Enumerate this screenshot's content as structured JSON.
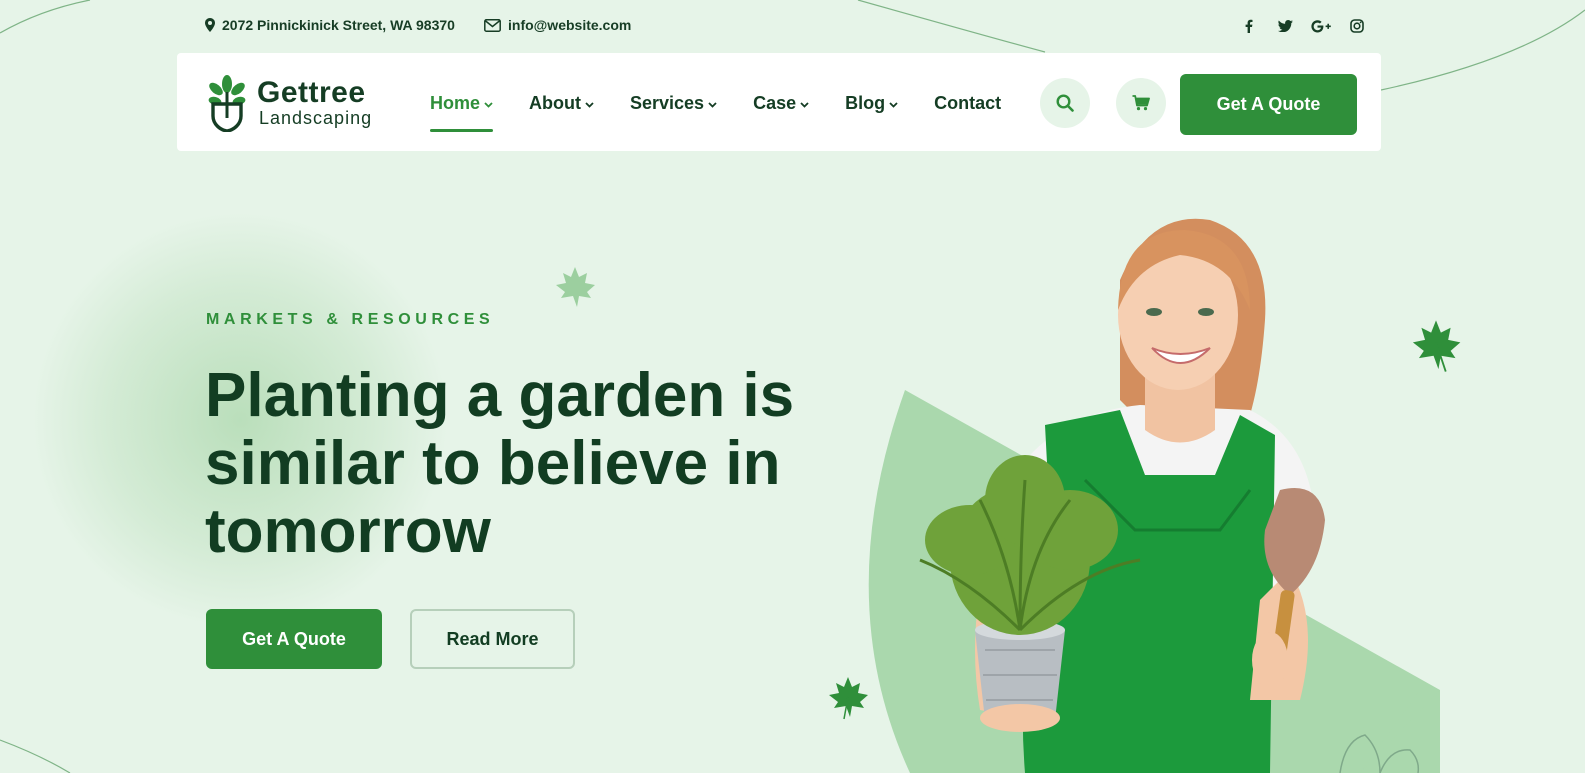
{
  "topbar": {
    "address": "2072 Pinnickinick Street, WA 98370",
    "email": "info@website.com",
    "social_icons": [
      "facebook-icon",
      "twitter-icon",
      "google-plus-icon",
      "instagram-icon"
    ]
  },
  "header": {
    "logo": {
      "name": "Gettree",
      "tagline": "Landscaping"
    },
    "nav": [
      {
        "label": "Home",
        "active": true,
        "dropdown": true
      },
      {
        "label": "About",
        "active": false,
        "dropdown": true
      },
      {
        "label": "Services",
        "active": false,
        "dropdown": true
      },
      {
        "label": "Case",
        "active": false,
        "dropdown": true
      },
      {
        "label": "Blog",
        "active": false,
        "dropdown": true
      },
      {
        "label": "Contact",
        "active": false,
        "dropdown": false
      }
    ],
    "search_icon": "search-icon",
    "cart_icon": "cart-icon",
    "cta_label": "Get A Quote"
  },
  "hero": {
    "eyebrow": "MARKETS & RESOURCES",
    "headline_lines": [
      "Planting a garden is",
      "similar to believe in",
      "tomorrow"
    ],
    "primary_button": "Get A Quote",
    "secondary_button": "Read More"
  },
  "colors": {
    "background": "#e6f4e8",
    "brand_green": "#2f8f3a",
    "dark_text": "#123d22"
  }
}
